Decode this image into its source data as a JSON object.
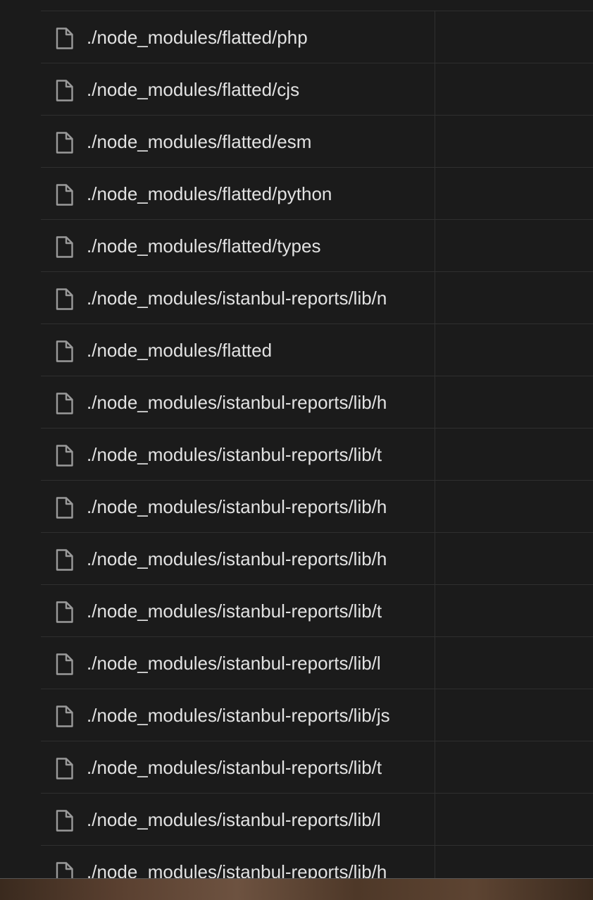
{
  "files": [
    {
      "path": "./node_modules/flatted/php"
    },
    {
      "path": "./node_modules/flatted/cjs"
    },
    {
      "path": "./node_modules/flatted/esm"
    },
    {
      "path": "./node_modules/flatted/python"
    },
    {
      "path": "./node_modules/flatted/types"
    },
    {
      "path": "./node_modules/istanbul-reports/lib/n"
    },
    {
      "path": "./node_modules/flatted"
    },
    {
      "path": "./node_modules/istanbul-reports/lib/h"
    },
    {
      "path": "./node_modules/istanbul-reports/lib/t"
    },
    {
      "path": "./node_modules/istanbul-reports/lib/h"
    },
    {
      "path": "./node_modules/istanbul-reports/lib/h"
    },
    {
      "path": "./node_modules/istanbul-reports/lib/t"
    },
    {
      "path": "./node_modules/istanbul-reports/lib/l"
    },
    {
      "path": "./node_modules/istanbul-reports/lib/js"
    },
    {
      "path": "./node_modules/istanbul-reports/lib/t"
    },
    {
      "path": "./node_modules/istanbul-reports/lib/l"
    },
    {
      "path": "./node_modules/istanbul-reports/lib/h"
    }
  ],
  "icon": "document-icon"
}
